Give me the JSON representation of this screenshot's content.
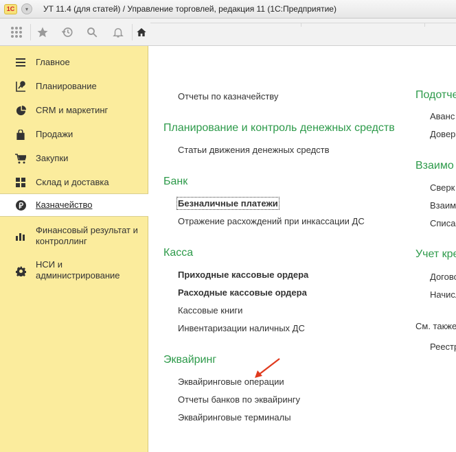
{
  "window": {
    "title": "УТ 11.4 (для статей) / Управление торговлей, редакция 11  (1С:Предприятие)",
    "logo_text": "1С"
  },
  "toolbar": {
    "icons": [
      "apps-grid-icon",
      "star-icon",
      "history-icon",
      "search-icon",
      "bell-icon",
      "home-icon"
    ]
  },
  "sidebar": {
    "items": [
      {
        "label": "Главное",
        "icon": "menu-lines-icon"
      },
      {
        "label": "Планирование",
        "icon": "planning-icon"
      },
      {
        "label": "CRM и маркетинг",
        "icon": "pie-chart-icon"
      },
      {
        "label": "Продажи",
        "icon": "shopping-bag-icon"
      },
      {
        "label": "Закупки",
        "icon": "cart-icon"
      },
      {
        "label": "Склад и доставка",
        "icon": "warehouse-grid-icon"
      },
      {
        "label": "Казначейство",
        "icon": "ruble-coin-icon",
        "active": true
      },
      {
        "label": "Финансовый результат и",
        "label2": "контроллинг",
        "icon": "bar-chart-icon"
      },
      {
        "label": "НСИ и",
        "label2": "администрирование",
        "icon": "gear-icon"
      }
    ]
  },
  "content": {
    "col1": {
      "top_link": "Отчеты по казначейству",
      "sections": [
        {
          "heading": "Планирование и контроль денежных средств",
          "links": [
            "Статьи движения денежных средств"
          ]
        },
        {
          "heading": "Банк",
          "links": [
            "Безналичные платежи",
            "Отражение расхождений при инкассации ДС"
          ]
        },
        {
          "heading": "Касса",
          "links": [
            "Приходные кассовые ордера",
            "Расходные кассовые ордера",
            "Кассовые книги",
            "Инвентаризации наличных ДС"
          ]
        },
        {
          "heading": "Эквайринг",
          "links": [
            "Эквайринговые операции",
            "Отчеты банков по эквайрингу",
            "Эквайринговые терминалы"
          ]
        }
      ]
    },
    "col2": {
      "sections": [
        {
          "heading": "Подотче",
          "links": [
            "Аванс",
            "Довер"
          ]
        },
        {
          "heading": "Взаимо",
          "links": [
            "Сверк",
            "Взаим",
            "Списа"
          ]
        },
        {
          "heading": "Учет кре",
          "links": [
            "Догово",
            "Начисл"
          ]
        }
      ],
      "see_also": "См. также",
      "see_also_links": [
        "Реестр"
      ]
    }
  },
  "colors": {
    "sidebar_bg": "#fbec9d",
    "heading_green": "#2d9a4a",
    "annotation_arrow": "#e03a1e"
  }
}
